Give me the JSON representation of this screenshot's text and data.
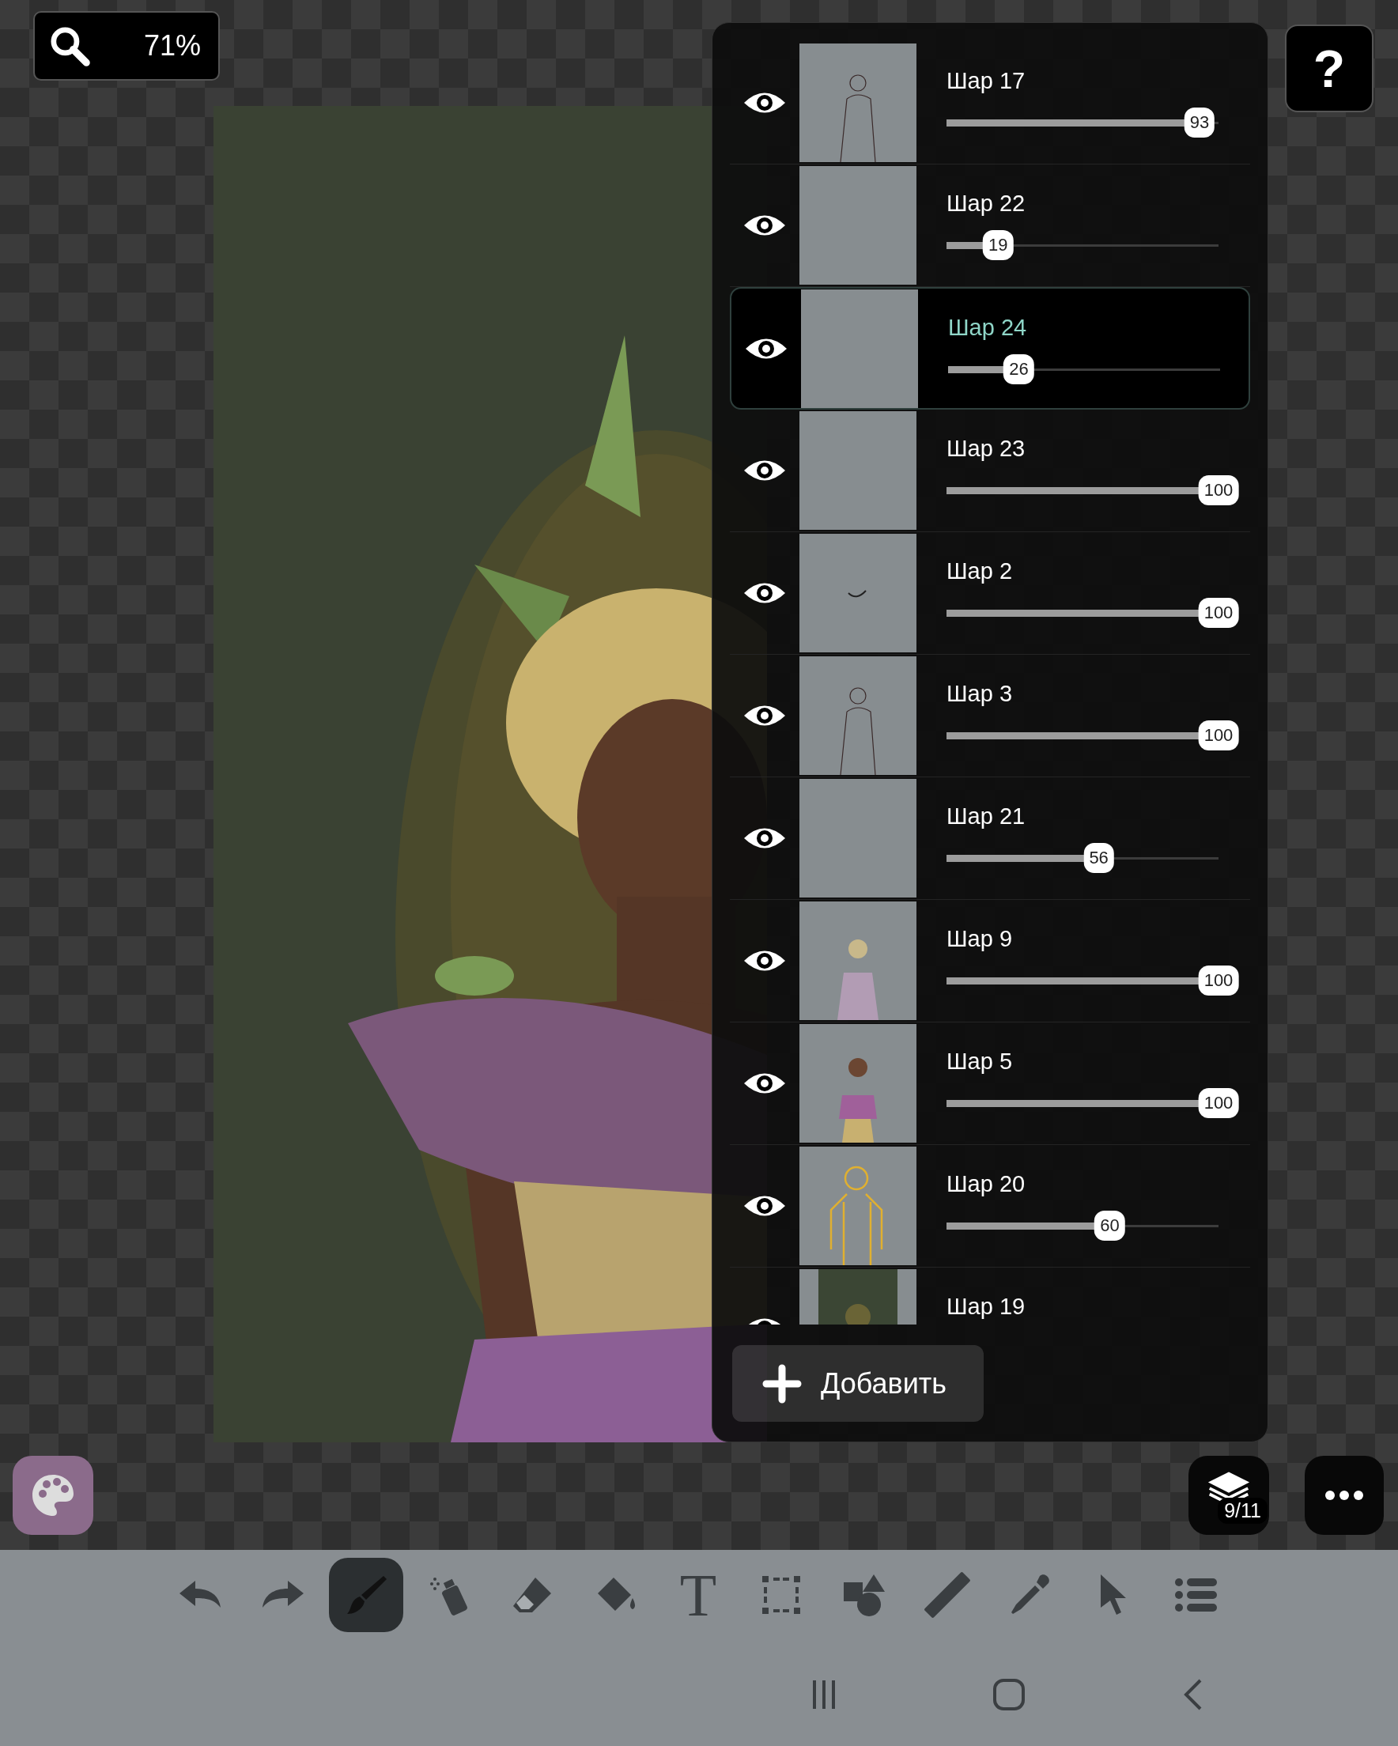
{
  "zoom": {
    "value": "71%"
  },
  "help_button": "?",
  "layers": [
    {
      "name": "Шар 17",
      "visible": true,
      "selected": false,
      "level": 0.93,
      "reading": "93"
    },
    {
      "name": "Шар 22",
      "visible": true,
      "selected": false,
      "level": 0.19,
      "reading": "19"
    },
    {
      "name": "Шар 24",
      "visible": true,
      "selected": true,
      "level": 0.26,
      "reading": "26"
    },
    {
      "name": "Шар 23",
      "visible": true,
      "selected": false,
      "level": 1,
      "reading": "100"
    },
    {
      "name": "Шар 2",
      "visible": true,
      "selected": false,
      "level": 1,
      "reading": "100"
    },
    {
      "name": "Шар 3",
      "visible": true,
      "selected": false,
      "level": 1,
      "reading": "100"
    },
    {
      "name": "Шар 21",
      "visible": true,
      "selected": false,
      "level": 0.56,
      "reading": "56"
    },
    {
      "name": "Шар 9",
      "visible": true,
      "selected": false,
      "level": 1,
      "reading": "100"
    },
    {
      "name": "Шар 5",
      "visible": true,
      "selected": false,
      "level": 1,
      "reading": "100"
    },
    {
      "name": "Шар 20",
      "visible": true,
      "selected": false,
      "level": 0.6,
      "reading": "60"
    },
    {
      "name": "Шар 19",
      "visible": true,
      "selected": false
    }
  ],
  "add_button": "Добавить",
  "layers_button": {
    "badge": "9/11"
  },
  "tools": [
    {
      "kind": "undo",
      "selected": false
    },
    {
      "kind": "redo",
      "selected": false
    },
    {
      "kind": "brush",
      "selected": true
    },
    {
      "kind": "spray",
      "selected": false
    },
    {
      "kind": "eraser",
      "selected": false
    },
    {
      "kind": "bucket",
      "selected": false
    },
    {
      "kind": "text",
      "label": "T",
      "selected": false
    },
    {
      "kind": "select",
      "selected": false
    },
    {
      "kind": "shapes",
      "selected": false
    },
    {
      "kind": "ruler",
      "selected": false
    },
    {
      "kind": "eyedropper",
      "selected": false
    },
    {
      "kind": "pointer",
      "selected": false
    },
    {
      "kind": "list",
      "selected": false
    }
  ]
}
